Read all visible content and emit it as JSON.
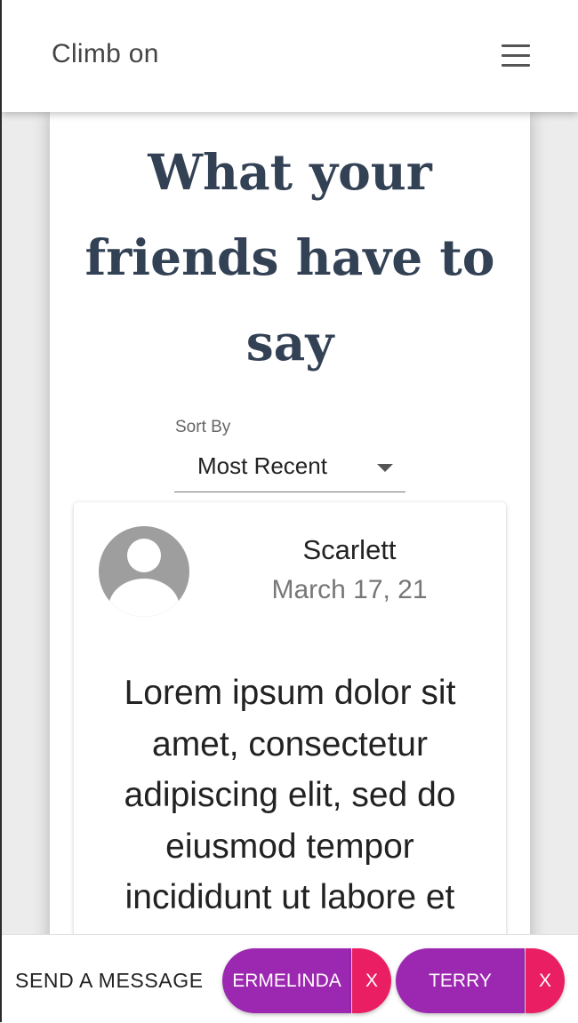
{
  "app": {
    "title": "Climb on",
    "menu_icon": "hamburger-menu-icon"
  },
  "page": {
    "title": "What your friends have to say"
  },
  "sort": {
    "label": "Sort By",
    "selected": "Most Recent"
  },
  "reviews": [
    {
      "name": "Scarlett",
      "date": "March 17, 21",
      "avatar_icon": "default-avatar-icon",
      "text": "Lorem ipsum dolor sit amet, consectetur adipiscing elit, sed do eiusmod tempor incididunt ut labore et"
    }
  ],
  "message_bar": {
    "label": "SEND A MESSAGE",
    "recipients": [
      {
        "name": "ERMELINDA",
        "remove_label": "X"
      },
      {
        "name": "TERRY",
        "remove_label": "X"
      }
    ]
  },
  "colors": {
    "title_text": "#334155",
    "chip_name": "#9c27b0",
    "chip_remove": "#e91e63"
  }
}
